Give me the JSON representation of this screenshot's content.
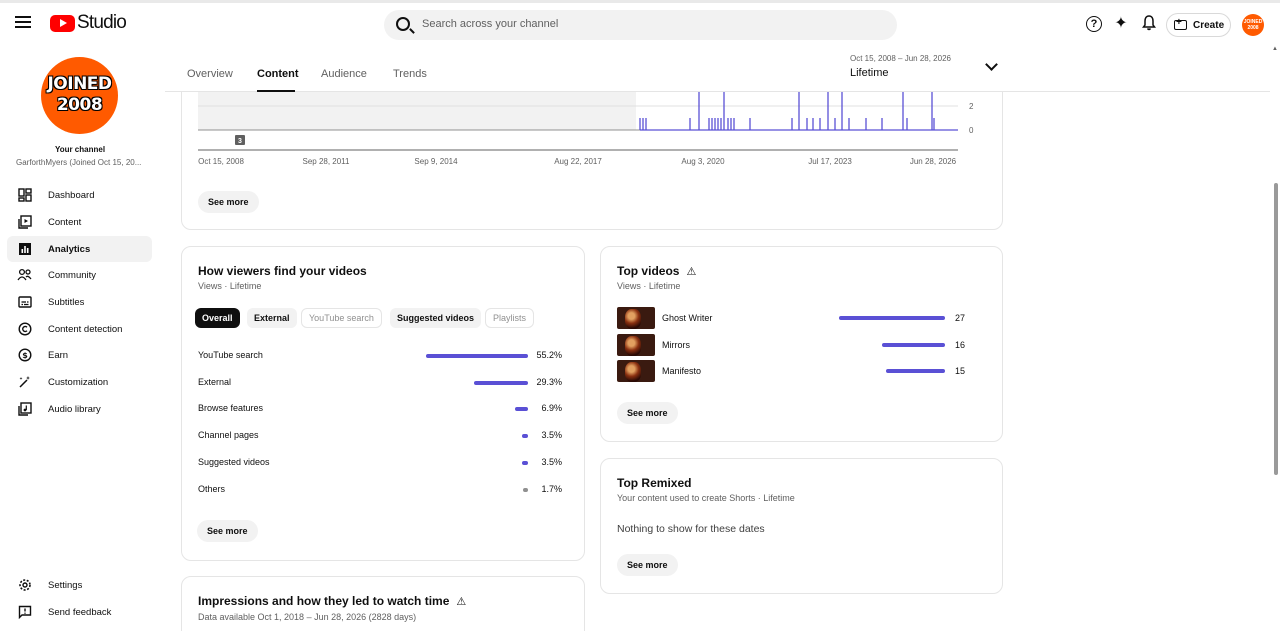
{
  "header": {
    "app_name": "Studio",
    "search_placeholder": "Search across your channel",
    "create_label": "Create",
    "avatar_text_line1": "JOINED",
    "avatar_text_line2": "2008"
  },
  "sidebar": {
    "avatar_line1": "JOINED",
    "avatar_line2": "2008",
    "your_channel": "Your channel",
    "channel_name": "GarforthMyers (Joined Oct 15, 20...",
    "items": [
      {
        "label": "Dashboard",
        "icon": "dashboard-icon"
      },
      {
        "label": "Content",
        "icon": "content-icon"
      },
      {
        "label": "Analytics",
        "icon": "analytics-icon",
        "active": true
      },
      {
        "label": "Community",
        "icon": "community-icon"
      },
      {
        "label": "Subtitles",
        "icon": "subtitles-icon"
      },
      {
        "label": "Content detection",
        "icon": "copyright-icon"
      },
      {
        "label": "Earn",
        "icon": "dollar-icon"
      },
      {
        "label": "Customization",
        "icon": "magic-wand-icon"
      },
      {
        "label": "Audio library",
        "icon": "audio-library-icon"
      }
    ],
    "bottom": [
      {
        "label": "Settings",
        "icon": "gear-icon"
      },
      {
        "label": "Send feedback",
        "icon": "feedback-icon"
      }
    ]
  },
  "tabs": [
    "Overview",
    "Content",
    "Audience",
    "Trends"
  ],
  "active_tab": "Content",
  "date_range": {
    "range": "Oct 15, 2008 – Jun 28, 2026",
    "label": "Lifetime"
  },
  "timeline": {
    "x_ticks": [
      "Oct 15, 2008",
      "Sep 28, 2011",
      "Sep 9, 2014",
      "Aug 22, 2017",
      "Aug 3, 2020",
      "Jul 17, 2023",
      "Jun 28, 2026"
    ],
    "y_ticks": [
      "2",
      "0"
    ],
    "marker": "3",
    "see_more": "See more"
  },
  "traffic": {
    "title": "How viewers find your videos",
    "subtitle": "Views · Lifetime",
    "chips": [
      "Overall",
      "External",
      "YouTube search",
      "Suggested videos",
      "Playlists"
    ],
    "rows": [
      {
        "label": "YouTube search",
        "pct": "55.2%",
        "value": 55.2
      },
      {
        "label": "External",
        "pct": "29.3%",
        "value": 29.3
      },
      {
        "label": "Browse features",
        "pct": "6.9%",
        "value": 6.9
      },
      {
        "label": "Channel pages",
        "pct": "3.5%",
        "value": 3.5
      },
      {
        "label": "Suggested videos",
        "pct": "3.5%",
        "value": 3.5
      },
      {
        "label": "Others",
        "pct": "1.7%",
        "value": 1.7
      }
    ],
    "see_more": "See more"
  },
  "top_videos": {
    "title": "Top videos",
    "subtitle": "Views · Lifetime",
    "rows": [
      {
        "title": "Ghost Writer",
        "views": "27",
        "value": 27
      },
      {
        "title": "Mirrors",
        "views": "16",
        "value": 16
      },
      {
        "title": "Manifesto",
        "views": "15",
        "value": 15
      }
    ],
    "see_more": "See more"
  },
  "top_remixed": {
    "title": "Top Remixed",
    "subtitle": "Your content used to create Shorts · Lifetime",
    "empty": "Nothing to show for these dates",
    "see_more": "See more"
  },
  "impressions": {
    "title": "Impressions and how they led to watch time",
    "subtitle": "Data available Oct 1, 2018 – Jun 28, 2026 (2828 days)"
  },
  "colors": {
    "accent": "#5a50d5",
    "brand_red": "#ff0000",
    "avatar_orange": "#ff5a00"
  }
}
